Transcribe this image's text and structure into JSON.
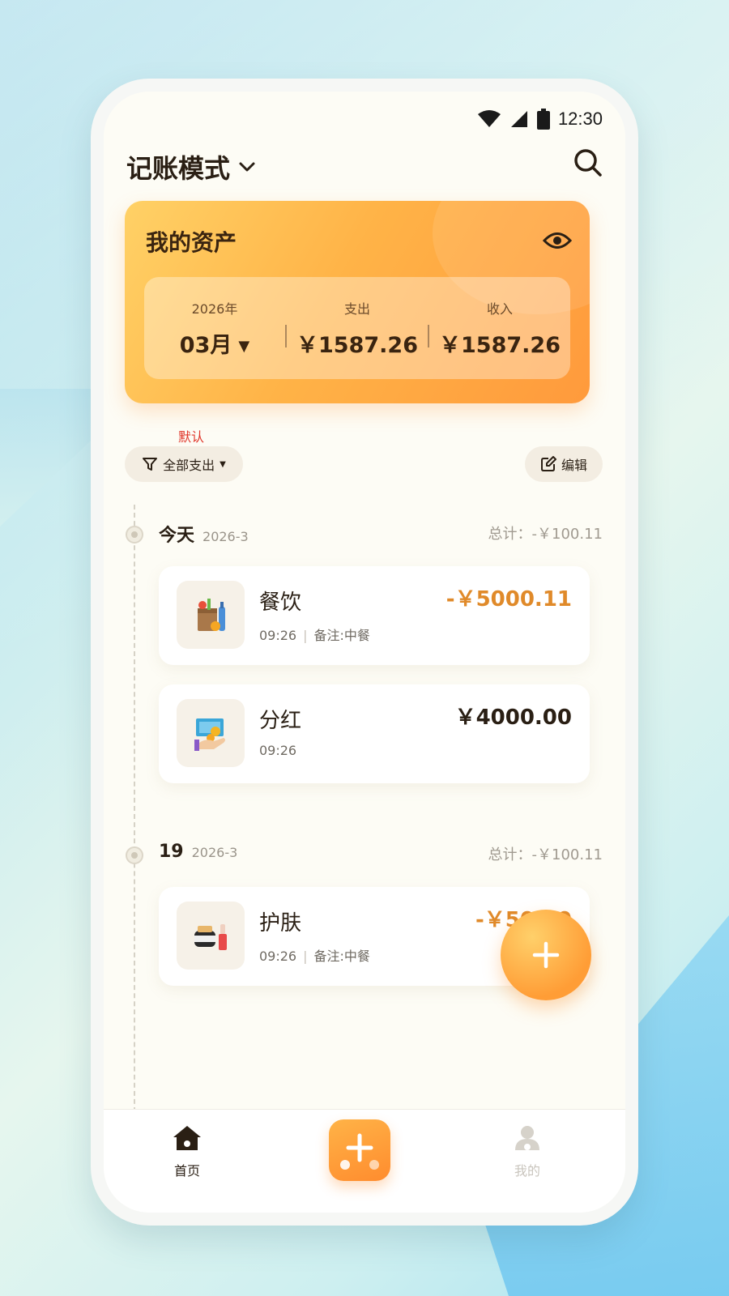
{
  "status_bar": {
    "time": "12:30"
  },
  "header": {
    "title": "记账模式"
  },
  "assets": {
    "title": "我的资产",
    "year": "2026年",
    "month": "03月",
    "expense_label": "支出",
    "expense_value": "￥1587.26",
    "income_label": "收入",
    "income_value": "￥1587.26"
  },
  "filter": {
    "default_tag": "默认",
    "label": "全部支出",
    "edit_label": "编辑"
  },
  "groups": [
    {
      "day": "今天",
      "date": "2026-3",
      "total": "总计：-￥100.11",
      "items": [
        {
          "name": "餐饮",
          "time": "09:26",
          "note": "备注:中餐",
          "amount": "-￥5000.11",
          "icon": "grocery-bag-icon"
        },
        {
          "name": "分红",
          "time": "09:26",
          "note": "",
          "amount": "￥4000.00",
          "icon": "money-hand-icon"
        }
      ]
    },
    {
      "day": "19",
      "date": "2026-3",
      "total": "总计：-￥100.11",
      "items": [
        {
          "name": "护肤",
          "time": "09:26",
          "note": "备注:中餐",
          "amount": "-￥50.00",
          "icon": "cosmetics-icon"
        }
      ]
    }
  ],
  "tabbar": {
    "home": "首页",
    "me": "我的"
  },
  "colors": {
    "accent": "#ff9d36",
    "expense": "#e08a2a",
    "default_tag": "#e0362a"
  }
}
